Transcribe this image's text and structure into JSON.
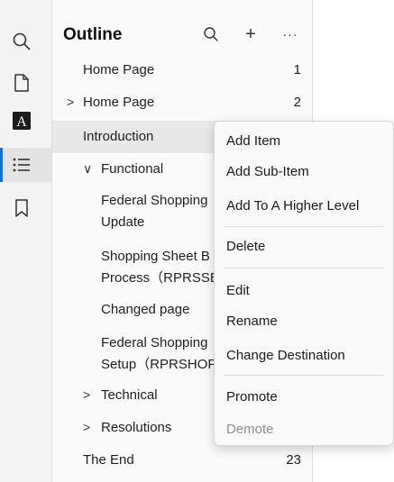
{
  "rail": {
    "icons": [
      "search-icon",
      "page-icon",
      "font-icon",
      "outline-icon",
      "bookmark-icon"
    ],
    "active": "outline-icon"
  },
  "panel": {
    "title": "Outline",
    "search_icon": "search-icon",
    "add_icon": "plus-icon",
    "more_icon": "more-icon",
    "add_glyph": "+",
    "more_glyph": "···"
  },
  "outline": [
    {
      "label": "Home Page",
      "page": "1",
      "chevron": "",
      "level": 0
    },
    {
      "label": "Home Page",
      "page": "2",
      "chevron": ">",
      "level": 0
    },
    {
      "label": "Introduction",
      "page": "",
      "chevron": "",
      "level": 0,
      "selected": true
    },
    {
      "label": "Functional",
      "page": "",
      "chevron": "∨",
      "level": 1
    },
    {
      "label_line1": "Federal Shopping",
      "label_line2": "Update",
      "page": "",
      "level": 2
    },
    {
      "label_line1": "Shopping Sheet B",
      "label_line2": "Process（RPRSSB",
      "page": "",
      "level": 2
    },
    {
      "label": "Changed page",
      "page": "",
      "level": 2
    },
    {
      "label_line1": "Federal Shopping",
      "label_line2": "Setup（RPRSHOP",
      "page": "",
      "level": 2
    },
    {
      "label": "Technical",
      "page": "",
      "chevron": ">",
      "level": 1
    },
    {
      "label": "Resolutions",
      "page": "",
      "chevron": ">",
      "level": 1
    },
    {
      "label": "The End",
      "page": "23",
      "chevron": "",
      "level": 0
    }
  ],
  "context_menu": {
    "items": [
      {
        "label": "Add Item",
        "enabled": true
      },
      {
        "label": "Add Sub-Item",
        "enabled": true
      },
      {
        "label": "Add To A Higher Level",
        "enabled": true
      },
      {
        "label": "Delete",
        "enabled": true
      },
      {
        "label": "Edit",
        "enabled": true
      },
      {
        "label": "Rename",
        "enabled": true
      },
      {
        "label": "Change Destination",
        "enabled": true
      },
      {
        "label": "Promote",
        "enabled": true
      },
      {
        "label": "Demote",
        "enabled": false
      }
    ]
  },
  "colors": {
    "accent": "#1a6fc9",
    "rail_bg": "#f3f3f3",
    "panel_bg": "#fafafa",
    "selected_row": "#e8e8e8",
    "menu_bg": "#f9f9f9",
    "disabled_text": "#8f8f8f"
  }
}
